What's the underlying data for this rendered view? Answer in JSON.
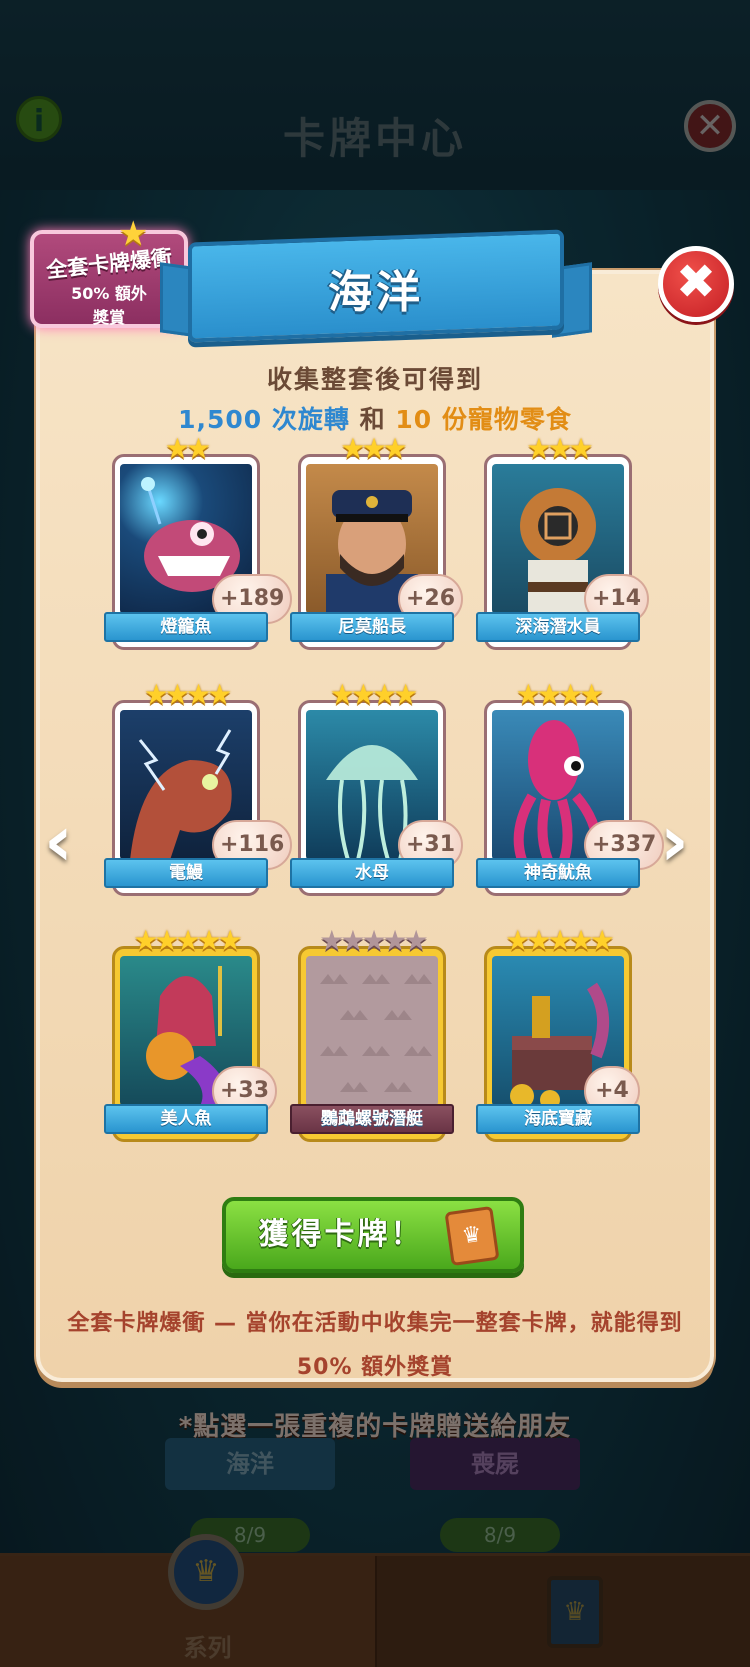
{
  "background": {
    "title": "卡牌中心",
    "info_icon": "i",
    "close_icon": "✕",
    "share_note": "*點選一張重複的卡牌贈送給朋友",
    "sets": [
      {
        "name": "海洋",
        "progress": "8/9"
      },
      {
        "name": "喪屍",
        "progress": "8/9"
      }
    ],
    "nav": {
      "series_label": "系列"
    }
  },
  "popup": {
    "ribbon_title": "海洋",
    "bonus_badge": {
      "title": "全套卡牌爆衝",
      "pct": "50% 額外",
      "sub": "獎賞"
    },
    "close_icon": "✖",
    "collect_text": "收集整套後可得到",
    "reward": {
      "spins": "1,500",
      "spins_label": " 次旋轉 ",
      "and": "和",
      "snacks": " 10 ",
      "snacks_label": "份寵物零食"
    },
    "cards": [
      {
        "name": "燈籠魚",
        "stars": "★★",
        "count": "+189",
        "owned": true
      },
      {
        "name": "尼莫船長",
        "stars": "★★★",
        "count": "+26",
        "owned": true
      },
      {
        "name": "深海潛水員",
        "stars": "★★★",
        "count": "+14",
        "owned": true
      },
      {
        "name": "電鰻",
        "stars": "★★★★",
        "count": "+116",
        "owned": true
      },
      {
        "name": "水母",
        "stars": "★★★★",
        "count": "+31",
        "owned": true
      },
      {
        "name": "神奇魷魚",
        "stars": "★★★★",
        "count": "+337",
        "owned": true
      },
      {
        "name": "美人魚",
        "stars": "★★★★★",
        "count": "+33",
        "owned": true
      },
      {
        "name": "鸚鵡螺號潛艇",
        "stars": "★★★★★",
        "count": "",
        "owned": false
      },
      {
        "name": "海底寶藏",
        "stars": "★★★★★",
        "count": "+4",
        "owned": true
      }
    ],
    "get_button": "獲得卡牌！",
    "footer_text": "全套卡牌爆衝 — 當你在活動中收集完一整套卡牌，就能得到 50% 額外獎賞"
  },
  "arrows": {
    "left": "‹",
    "right": "›"
  },
  "colors": {
    "ribbon": "#2a8fcc",
    "button": "#4aa81c",
    "close": "#c41e24",
    "panel": "#f7e4c6"
  }
}
